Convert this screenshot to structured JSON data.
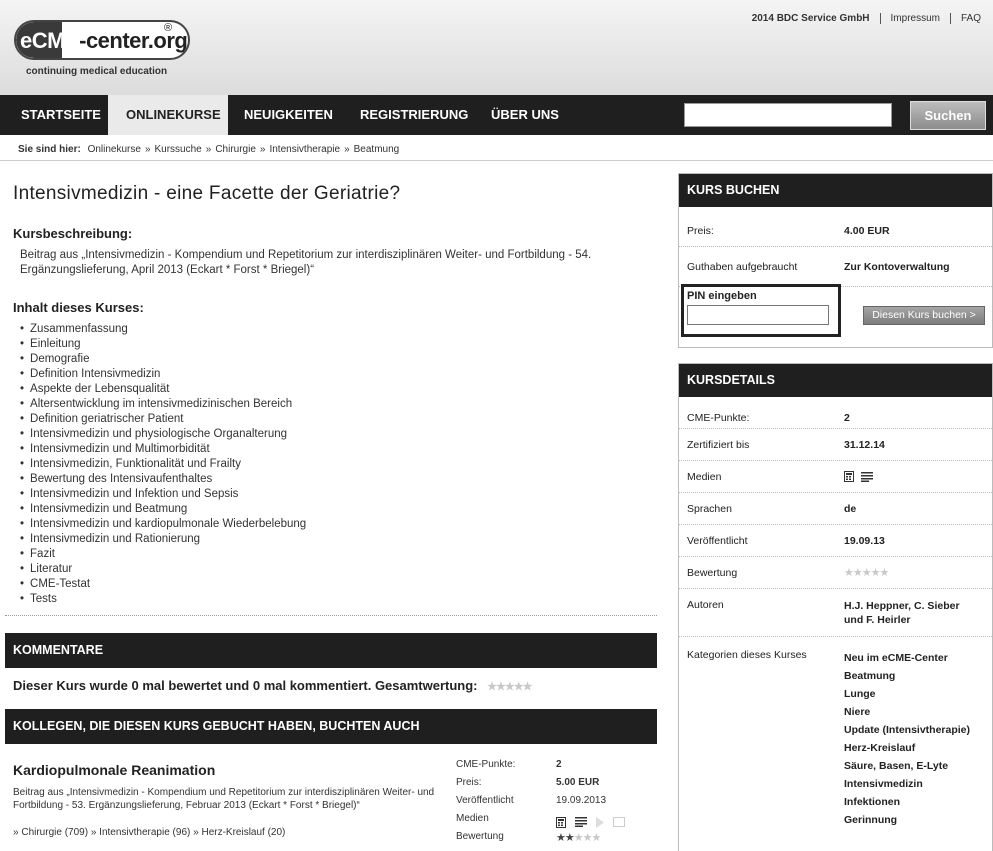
{
  "header": {
    "logo_left": "eCME",
    "logo_right": "-center.org",
    "logo_reg": "®",
    "tagline": "continuing medical education",
    "links": [
      "2014 BDC Service GmbH",
      "Impressum",
      "FAQ"
    ]
  },
  "nav": {
    "items": [
      "STARTSEITE",
      "ONLINEKURSE",
      "NEUIGKEITEN",
      "REGISTRIERUNG",
      "ÜBER UNS"
    ],
    "active": "ONLINEKURSE",
    "search_value": "",
    "search_button": "Suchen"
  },
  "breadcrumb": {
    "prefix": "Sie sind hier:",
    "items": [
      "Onlinekurse",
      "Kurssuche",
      "Chirurgie",
      "Intensivtherapie",
      "Beatmung"
    ]
  },
  "main": {
    "title": "Intensivmedizin - eine Facette der Geriatrie?",
    "desc_heading": "Kursbeschreibung:",
    "description": "Beitrag aus „Intensivmedizin - Kompendium und Repetitorium zur interdisziplinären Weiter- und Fortbildung - 54. Ergänzungslieferung, April 2013 (Eckart * Forst * Briegel)“",
    "content_heading": "Inhalt dieses Kurses:",
    "contents": [
      "Zusammenfassung",
      "Einleitung",
      "Demografie",
      "Definition Intensivmedizin",
      "Aspekte der Lebensqualität",
      "Altersentwicklung im intensivmedizinischen Bereich",
      "Definition geriatrischer Patient",
      "Intensivmedizin und physiologische Organalterung",
      "Intensivmedizin und Multimorbidität",
      "Intensivmedizin, Funktionalität und Frailty",
      "Bewertung des Intensivaufenthaltes",
      "Intensivmedizin und Infektion und Sepsis",
      "Intensivmedizin und Beatmung",
      "Intensivmedizin und kardiopulmonale Wiederbelebung",
      "Intensivmedizin und Rationierung",
      "Fazit",
      "Literatur",
      "CME-Testat",
      "Tests"
    ]
  },
  "comments": {
    "heading": "KOMMENTARE",
    "summary": "Dieser Kurs wurde 0 mal bewertet und 0 mal kommentiert. Gesamtwertung:",
    "rating": 0
  },
  "related": {
    "heading": "KOLLEGEN, DIE DIESEN KURS GEBUCHT HABEN, BUCHTEN AUCH",
    "title": "Kardiopulmonale Reanimation",
    "description": "Beitrag aus „Intensivmedizin - Kompendium und Repetitorium zur interdisziplinären Weiter- und Fortbildung - 53. Ergänzungslieferung, Februar 2013 (Eckart * Forst * Briegel)“",
    "categories": [
      "Chirurgie (709)",
      "Intensivtherapie (96)",
      "Herz-Kreislauf (20)"
    ],
    "meta": {
      "cme_label": "CME-Punkte:",
      "cme_value": "2",
      "price_label": "Preis:",
      "price_value": "5.00 EUR",
      "published_label": "Veröffentlicht",
      "published_value": "19.09.2013",
      "media_label": "Medien",
      "rating_label": "Bewertung",
      "rating": 2
    }
  },
  "booking": {
    "heading": "KURS BUCHEN",
    "price_label": "Preis:",
    "price_value": "4.00 EUR",
    "credit_label": "Guthaben aufgebraucht",
    "credit_link": "Zur Kontoverwaltung",
    "pin_label": "PIN eingeben",
    "pin_value": "",
    "book_button": "Diesen Kurs buchen >"
  },
  "details": {
    "heading": "KURSDETAILS",
    "cme_label": "CME-Punkte:",
    "cme_value": "2",
    "cert_label": "Zertifiziert bis",
    "cert_value": "31.12.14",
    "media_label": "Medien",
    "lang_label": "Sprachen",
    "lang_value": "de",
    "pub_label": "Veröffentlicht",
    "pub_value": "19.09.13",
    "rating_label": "Bewertung",
    "rating": 0,
    "authors_label": "Autoren",
    "authors_line1": "H.J. Heppner, C. Sieber",
    "authors_line2": "und F. Heirler",
    "categories_label": "Kategorien dieses Kurses",
    "categories": [
      "Neu im eCME-Center",
      "Beatmung",
      "Lunge",
      "Niere",
      "Update (Intensivtherapie)",
      "Herz-Kreislauf",
      "Säure, Basen, E-Lyte",
      "Intensivmedizin",
      "Infektionen",
      "Gerinnung"
    ]
  },
  "icons": {
    "star": "★",
    "breadcrumb_sep": "»",
    "media_doc": "document-icon",
    "media_text": "text-lines-icon",
    "media_play": "play-icon",
    "media_window": "window-icon"
  }
}
